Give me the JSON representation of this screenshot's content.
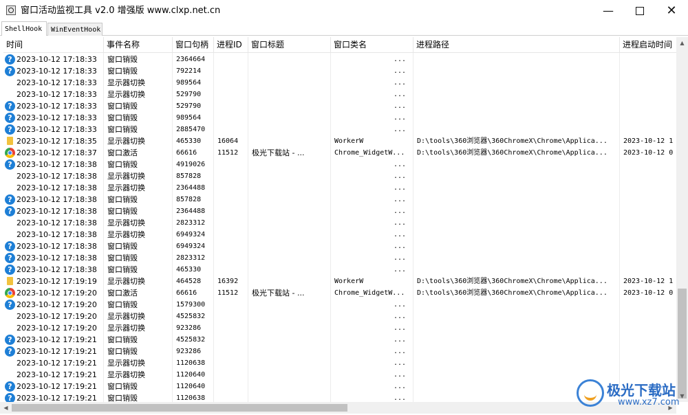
{
  "window": {
    "title": "窗口活动监视工具 v2.0 增强版 www.clxp.net.cn",
    "minimize_icon": "minimize-icon",
    "maximize_icon": "maximize-icon",
    "close_icon": "close-icon"
  },
  "tabs": [
    {
      "label": "ShellHook",
      "active": true
    },
    {
      "label": "WinEventHook",
      "active": false
    }
  ],
  "columns": [
    "时间",
    "事件名称",
    "窗口句柄",
    "进程ID",
    "窗口标题",
    "窗口类名",
    "进程路径",
    "进程启动时间"
  ],
  "rows": [
    {
      "icon": "q",
      "time": "2023-10-12 17:18:33",
      "event": "窗口销毁",
      "hwnd": "2364664",
      "pid": "",
      "title": "",
      "cls": "...",
      "path": "",
      "start": ""
    },
    {
      "icon": "q",
      "time": "2023-10-12 17:18:33",
      "event": "窗口销毁",
      "hwnd": "792214",
      "pid": "",
      "title": "",
      "cls": "...",
      "path": "",
      "start": ""
    },
    {
      "icon": "",
      "time": "2023-10-12 17:18:33",
      "event": "显示器切换",
      "hwnd": "989564",
      "pid": "",
      "title": "",
      "cls": "...",
      "path": "",
      "start": ""
    },
    {
      "icon": "",
      "time": "2023-10-12 17:18:33",
      "event": "显示器切换",
      "hwnd": "529790",
      "pid": "",
      "title": "",
      "cls": "...",
      "path": "",
      "start": ""
    },
    {
      "icon": "q",
      "time": "2023-10-12 17:18:33",
      "event": "窗口销毁",
      "hwnd": "529790",
      "pid": "",
      "title": "",
      "cls": "...",
      "path": "",
      "start": ""
    },
    {
      "icon": "q",
      "time": "2023-10-12 17:18:33",
      "event": "窗口销毁",
      "hwnd": "989564",
      "pid": "",
      "title": "",
      "cls": "...",
      "path": "",
      "start": ""
    },
    {
      "icon": "q",
      "time": "2023-10-12 17:18:33",
      "event": "窗口销毁",
      "hwnd": "2885470",
      "pid": "",
      "title": "",
      "cls": "...",
      "path": "",
      "start": ""
    },
    {
      "icon": "f",
      "time": "2023-10-12 17:18:35",
      "event": "显示器切换",
      "hwnd": "465330",
      "pid": "16064",
      "title": "",
      "cls": "WorkerW",
      "path": "D:\\tools\\360浏览器\\360ChromeX\\Chrome\\Applica...",
      "start": "2023-10-12 1"
    },
    {
      "icon": "c",
      "time": "2023-10-12 17:18:37",
      "event": "窗口激活",
      "hwnd": "66616",
      "pid": "11512",
      "title": "极光下载站 - ...",
      "cls": "Chrome_WidgetW...",
      "path": "D:\\tools\\360浏览器\\360ChromeX\\Chrome\\Applica...",
      "start": "2023-10-12 0"
    },
    {
      "icon": "q",
      "time": "2023-10-12 17:18:38",
      "event": "窗口销毁",
      "hwnd": "4919026",
      "pid": "",
      "title": "",
      "cls": "...",
      "path": "",
      "start": ""
    },
    {
      "icon": "",
      "time": "2023-10-12 17:18:38",
      "event": "显示器切换",
      "hwnd": "857828",
      "pid": "",
      "title": "",
      "cls": "...",
      "path": "",
      "start": ""
    },
    {
      "icon": "",
      "time": "2023-10-12 17:18:38",
      "event": "显示器切换",
      "hwnd": "2364488",
      "pid": "",
      "title": "",
      "cls": "...",
      "path": "",
      "start": ""
    },
    {
      "icon": "q",
      "time": "2023-10-12 17:18:38",
      "event": "窗口销毁",
      "hwnd": "857828",
      "pid": "",
      "title": "",
      "cls": "...",
      "path": "",
      "start": ""
    },
    {
      "icon": "q",
      "time": "2023-10-12 17:18:38",
      "event": "窗口销毁",
      "hwnd": "2364488",
      "pid": "",
      "title": "",
      "cls": "...",
      "path": "",
      "start": ""
    },
    {
      "icon": "",
      "time": "2023-10-12 17:18:38",
      "event": "显示器切换",
      "hwnd": "2823312",
      "pid": "",
      "title": "",
      "cls": "...",
      "path": "",
      "start": ""
    },
    {
      "icon": "",
      "time": "2023-10-12 17:18:38",
      "event": "显示器切换",
      "hwnd": "6949324",
      "pid": "",
      "title": "",
      "cls": "...",
      "path": "",
      "start": ""
    },
    {
      "icon": "q",
      "time": "2023-10-12 17:18:38",
      "event": "窗口销毁",
      "hwnd": "6949324",
      "pid": "",
      "title": "",
      "cls": "...",
      "path": "",
      "start": ""
    },
    {
      "icon": "q",
      "time": "2023-10-12 17:18:38",
      "event": "窗口销毁",
      "hwnd": "2823312",
      "pid": "",
      "title": "",
      "cls": "...",
      "path": "",
      "start": ""
    },
    {
      "icon": "q",
      "time": "2023-10-12 17:18:38",
      "event": "窗口销毁",
      "hwnd": "465330",
      "pid": "",
      "title": "",
      "cls": "...",
      "path": "",
      "start": ""
    },
    {
      "icon": "f",
      "time": "2023-10-12 17:19:19",
      "event": "显示器切换",
      "hwnd": "464528",
      "pid": "16392",
      "title": "",
      "cls": "WorkerW",
      "path": "D:\\tools\\360浏览器\\360ChromeX\\Chrome\\Applica...",
      "start": "2023-10-12 1"
    },
    {
      "icon": "c",
      "time": "2023-10-12 17:19:20",
      "event": "窗口激活",
      "hwnd": "66616",
      "pid": "11512",
      "title": "极光下载站 - ...",
      "cls": "Chrome_WidgetW...",
      "path": "D:\\tools\\360浏览器\\360ChromeX\\Chrome\\Applica...",
      "start": "2023-10-12 0"
    },
    {
      "icon": "q",
      "time": "2023-10-12 17:19:20",
      "event": "窗口销毁",
      "hwnd": "1579300",
      "pid": "",
      "title": "",
      "cls": "...",
      "path": "",
      "start": ""
    },
    {
      "icon": "",
      "time": "2023-10-12 17:19:20",
      "event": "显示器切换",
      "hwnd": "4525832",
      "pid": "",
      "title": "",
      "cls": "...",
      "path": "",
      "start": ""
    },
    {
      "icon": "",
      "time": "2023-10-12 17:19:20",
      "event": "显示器切换",
      "hwnd": "923286",
      "pid": "",
      "title": "",
      "cls": "...",
      "path": "",
      "start": ""
    },
    {
      "icon": "q",
      "time": "2023-10-12 17:19:21",
      "event": "窗口销毁",
      "hwnd": "4525832",
      "pid": "",
      "title": "",
      "cls": "...",
      "path": "",
      "start": ""
    },
    {
      "icon": "q",
      "time": "2023-10-12 17:19:21",
      "event": "窗口销毁",
      "hwnd": "923286",
      "pid": "",
      "title": "",
      "cls": "...",
      "path": "",
      "start": ""
    },
    {
      "icon": "",
      "time": "2023-10-12 17:19:21",
      "event": "显示器切换",
      "hwnd": "1120638",
      "pid": "",
      "title": "",
      "cls": "...",
      "path": "",
      "start": ""
    },
    {
      "icon": "",
      "time": "2023-10-12 17:19:21",
      "event": "显示器切换",
      "hwnd": "1120640",
      "pid": "",
      "title": "",
      "cls": "...",
      "path": "",
      "start": ""
    },
    {
      "icon": "q",
      "time": "2023-10-12 17:19:21",
      "event": "窗口销毁",
      "hwnd": "1120640",
      "pid": "",
      "title": "",
      "cls": "...",
      "path": "",
      "start": ""
    },
    {
      "icon": "q",
      "time": "2023-10-12 17:19:21",
      "event": "窗口销毁",
      "hwnd": "1120638",
      "pid": "",
      "title": "",
      "cls": "...",
      "path": "",
      "start": ""
    }
  ],
  "watermark": {
    "title": "极光下载站",
    "url": "www.xz7.com"
  }
}
